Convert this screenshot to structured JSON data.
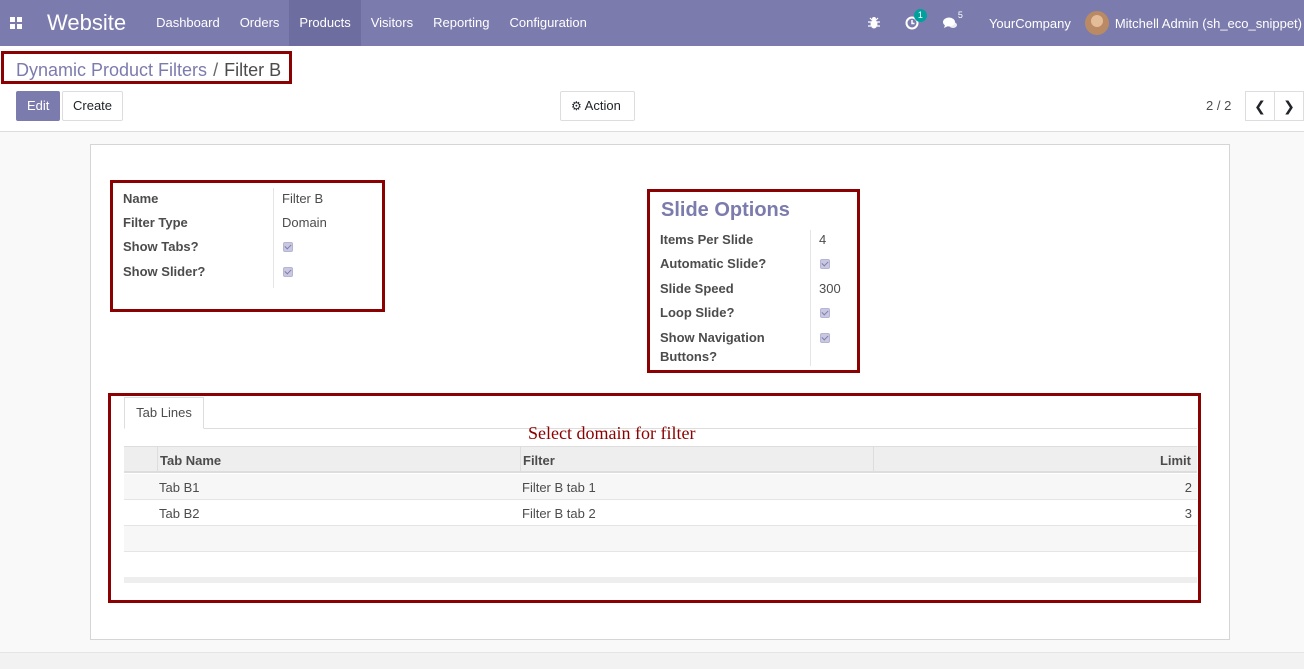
{
  "navbar": {
    "brand": "Website",
    "menu": [
      "Dashboard",
      "Orders",
      "Products",
      "Visitors",
      "Reporting",
      "Configuration"
    ],
    "active_index": 2,
    "activity_count": "1",
    "messages_count": "5",
    "company": "YourCompany",
    "user": "Mitchell Admin (sh_eco_snippet)"
  },
  "breadcrumb": {
    "parent": "Dynamic Product Filters",
    "separator": "/",
    "current": "Filter B"
  },
  "toolbar": {
    "edit_label": "Edit",
    "create_label": "Create",
    "action_label": "Action"
  },
  "pager": {
    "value": "2 / 2"
  },
  "form": {
    "name_label": "Name",
    "name_value": "Filter B",
    "filter_type_label": "Filter Type",
    "filter_type_value": "Domain",
    "show_tabs_label": "Show Tabs?",
    "show_tabs_checked": true,
    "show_slider_label": "Show Slider?",
    "show_slider_checked": true
  },
  "slide_options": {
    "title": "Slide Options",
    "items_per_slide_label": "Items Per Slide",
    "items_per_slide_value": "4",
    "automatic_slide_label": "Automatic Slide?",
    "automatic_slide_checked": true,
    "slide_speed_label": "Slide Speed",
    "slide_speed_value": "300",
    "loop_slide_label": "Loop Slide?",
    "loop_slide_checked": true,
    "show_nav_label_line1": "Show Navigation",
    "show_nav_label_line2": "Buttons?",
    "show_nav_checked": true
  },
  "tabs": {
    "tab_lines_label": "Tab Lines",
    "annotation": "Select domain for filter",
    "columns": {
      "name": "Tab Name",
      "filter": "Filter",
      "limit": "Limit"
    },
    "rows": [
      {
        "name": "Tab B1",
        "filter": "Filter B tab 1",
        "limit": "2"
      },
      {
        "name": "Tab B2",
        "filter": "Filter B tab 2",
        "limit": "3"
      }
    ]
  }
}
